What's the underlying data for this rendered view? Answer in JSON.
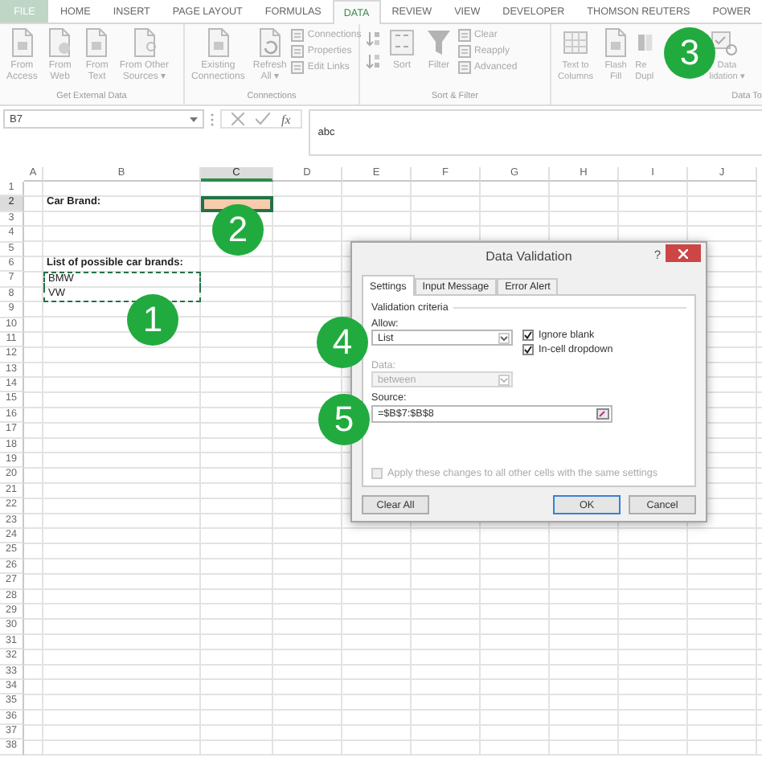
{
  "ribbon": {
    "tabs": [
      {
        "label": "FILE",
        "kind": "file",
        "selected": false
      },
      {
        "label": "HOME",
        "kind": "tab",
        "selected": false
      },
      {
        "label": "INSERT",
        "kind": "tab",
        "selected": false
      },
      {
        "label": "PAGE LAYOUT",
        "kind": "tab",
        "selected": false
      },
      {
        "label": "FORMULAS",
        "kind": "tab",
        "selected": false
      },
      {
        "label": "DATA",
        "kind": "tab",
        "selected": true
      },
      {
        "label": "REVIEW",
        "kind": "tab",
        "selected": false
      },
      {
        "label": "VIEW",
        "kind": "tab",
        "selected": false
      },
      {
        "label": "DEVELOPER",
        "kind": "tab",
        "selected": false
      },
      {
        "label": "THOMSON REUTERS",
        "kind": "tab",
        "selected": false
      },
      {
        "label": "POWER",
        "kind": "tab",
        "selected": false
      }
    ],
    "groups": [
      {
        "label": "Get External Data",
        "commands": [
          {
            "kind": "large",
            "lines": [
              "From",
              "Access"
            ]
          },
          {
            "kind": "large",
            "lines": [
              "From",
              "Web"
            ]
          },
          {
            "kind": "large",
            "lines": [
              "From",
              "Text"
            ]
          },
          {
            "kind": "large",
            "lines": [
              "From Other",
              "Sources ▾"
            ]
          }
        ]
      },
      {
        "label": "Connections",
        "commands": [
          {
            "kind": "large",
            "lines": [
              "Existing",
              "Connections"
            ]
          },
          {
            "kind": "large",
            "lines": [
              "Refresh",
              "All ▾"
            ]
          },
          {
            "kind": "stack",
            "items": [
              "Connections",
              "Properties",
              "Edit Links"
            ]
          }
        ]
      },
      {
        "label": "Sort & Filter",
        "commands": [
          {
            "kind": "sortpair"
          },
          {
            "kind": "large",
            "lines": [
              "Sort"
            ]
          },
          {
            "kind": "large",
            "lines": [
              "Filter"
            ]
          },
          {
            "kind": "stack",
            "items": [
              "Clear",
              "Reapply",
              "Advanced"
            ]
          }
        ]
      },
      {
        "label": "Data To",
        "commands": [
          {
            "kind": "large",
            "lines": [
              "Text to",
              "Columns"
            ]
          },
          {
            "kind": "large",
            "lines": [
              "Flash",
              "Fill"
            ]
          },
          {
            "kind": "large",
            "lines": [
              "Re",
              "Dupl"
            ]
          },
          {
            "kind": "large",
            "lines": [
              "Data",
              "lidation ▾"
            ]
          }
        ]
      }
    ]
  },
  "formula_bar": {
    "name_box": "B7",
    "function_button": "fx",
    "formula": "abc"
  },
  "sheet": {
    "columns": [
      {
        "label": "A",
        "selected": false
      },
      {
        "label": "B",
        "selected": false
      },
      {
        "label": "C",
        "selected": true
      },
      {
        "label": "D",
        "selected": false
      },
      {
        "label": "E",
        "selected": false
      },
      {
        "label": "F",
        "selected": false
      },
      {
        "label": "G",
        "selected": false
      },
      {
        "label": "H",
        "selected": false
      },
      {
        "label": "I",
        "selected": false
      },
      {
        "label": "J",
        "selected": false
      }
    ],
    "rows": [
      {
        "number": "1",
        "selected": false
      },
      {
        "number": "2",
        "selected": true,
        "cells": {
          "B": {
            "text": "Car Brand:",
            "bold": true
          },
          "C": {
            "selected": true,
            "color": "#f8cbad"
          }
        }
      },
      {
        "number": "3",
        "selected": false
      },
      {
        "number": "4",
        "selected": false
      },
      {
        "number": "5",
        "selected": false
      },
      {
        "number": "6",
        "selected": false,
        "cells": {
          "B": {
            "text": "List of possible car brands:",
            "bold": true
          }
        }
      },
      {
        "number": "7",
        "selected": false,
        "cells": {
          "B": {
            "text": "BMW",
            "marquee": true
          }
        }
      },
      {
        "number": "8",
        "selected": false,
        "cells": {
          "B": {
            "text": "VW",
            "marquee": true
          }
        }
      },
      {
        "number": "9",
        "selected": false
      },
      {
        "number": "10",
        "selected": false
      },
      {
        "number": "11",
        "selected": false
      },
      {
        "number": "12",
        "selected": false
      },
      {
        "number": "13",
        "selected": false
      },
      {
        "number": "14",
        "selected": false
      },
      {
        "number": "15",
        "selected": false
      },
      {
        "number": "16",
        "selected": false
      },
      {
        "number": "17",
        "selected": false
      },
      {
        "number": "18",
        "selected": false
      },
      {
        "number": "19",
        "selected": false
      },
      {
        "number": "20",
        "selected": false
      },
      {
        "number": "21",
        "selected": false
      },
      {
        "number": "22",
        "selected": false
      },
      {
        "number": "23",
        "selected": false
      },
      {
        "number": "24",
        "selected": false
      },
      {
        "number": "25",
        "selected": false
      },
      {
        "number": "26",
        "selected": false
      },
      {
        "number": "27",
        "selected": false
      },
      {
        "number": "28",
        "selected": false
      },
      {
        "number": "29",
        "selected": false
      },
      {
        "number": "30",
        "selected": false
      },
      {
        "number": "31",
        "selected": false
      },
      {
        "number": "32",
        "selected": false
      },
      {
        "number": "33",
        "selected": false
      },
      {
        "number": "34",
        "selected": false
      },
      {
        "number": "35",
        "selected": false
      },
      {
        "number": "36",
        "selected": false
      },
      {
        "number": "37",
        "selected": false
      },
      {
        "number": "38",
        "selected": false
      }
    ]
  },
  "dialog": {
    "title": "Data Validation",
    "help": "?",
    "tabs": [
      {
        "label": "Settings",
        "selected": true
      },
      {
        "label": "Input Message",
        "selected": false
      },
      {
        "label": "Error Alert",
        "selected": false
      }
    ],
    "group_label": "Validation criteria",
    "allow": {
      "label": "Allow:",
      "value": "List"
    },
    "checkboxes": [
      {
        "label": "Ignore blank",
        "checked": true
      },
      {
        "label": "In-cell dropdown",
        "checked": true
      }
    ],
    "data": {
      "label": "Data:",
      "value": "between",
      "disabled": true
    },
    "source": {
      "label": "Source:",
      "value": "=$B$7:$B$8"
    },
    "apply": {
      "label": "Apply these changes to all other cells with the same settings",
      "checked": false,
      "disabled": true
    },
    "buttons": [
      {
        "label": "Clear All",
        "default": false
      },
      {
        "label": "OK",
        "default": true
      },
      {
        "label": "Cancel",
        "default": false
      }
    ]
  },
  "callouts": [
    {
      "label": "1"
    },
    {
      "label": "2"
    },
    {
      "label": "3"
    },
    {
      "label": "4"
    },
    {
      "label": "5"
    }
  ]
}
